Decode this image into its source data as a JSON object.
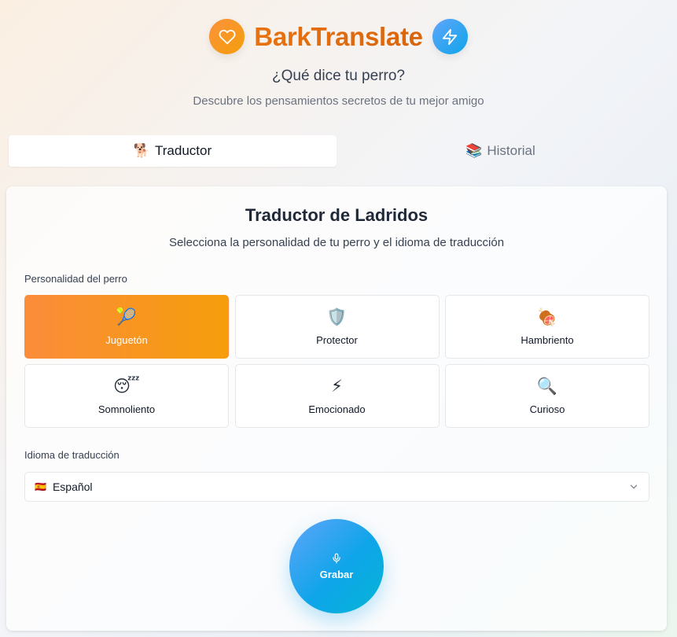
{
  "app": {
    "title": "BarkTranslate",
    "subtitle": "¿Qué dice tu perro?",
    "tagline": "Descubre los pensamientos secretos de tu mejor amigo"
  },
  "tabs": [
    {
      "icon": "🐕",
      "label": "Traductor",
      "active": true
    },
    {
      "icon": "📚",
      "label": "Historial",
      "active": false
    }
  ],
  "translator": {
    "title": "Traductor de Ladridos",
    "subtitle": "Selecciona la personalidad de tu perro y el idioma de traducción",
    "personality_label": "Personalidad del perro",
    "personalities": [
      {
        "emoji": "🎾",
        "label": "Juguetón",
        "selected": true
      },
      {
        "emoji": "🛡️",
        "label": "Protector",
        "selected": false
      },
      {
        "emoji": "🍖",
        "label": "Hambriento",
        "selected": false
      },
      {
        "emoji": "😴",
        "label": "Somnoliento",
        "selected": false
      },
      {
        "emoji": "⚡",
        "label": "Emocionado",
        "selected": false
      },
      {
        "emoji": "🔍",
        "label": "Curioso",
        "selected": false
      }
    ],
    "language_label": "Idioma de traducción",
    "language": {
      "flag": "🇪🇸",
      "value": "Español"
    },
    "record_label": "Grabar"
  },
  "colors": {
    "brand_orange": "#e8720f",
    "selected_gradient": [
      "#fb8c3a",
      "#f59e0b"
    ],
    "record_gradient": [
      "#60a5fa",
      "#06b6d4"
    ]
  }
}
